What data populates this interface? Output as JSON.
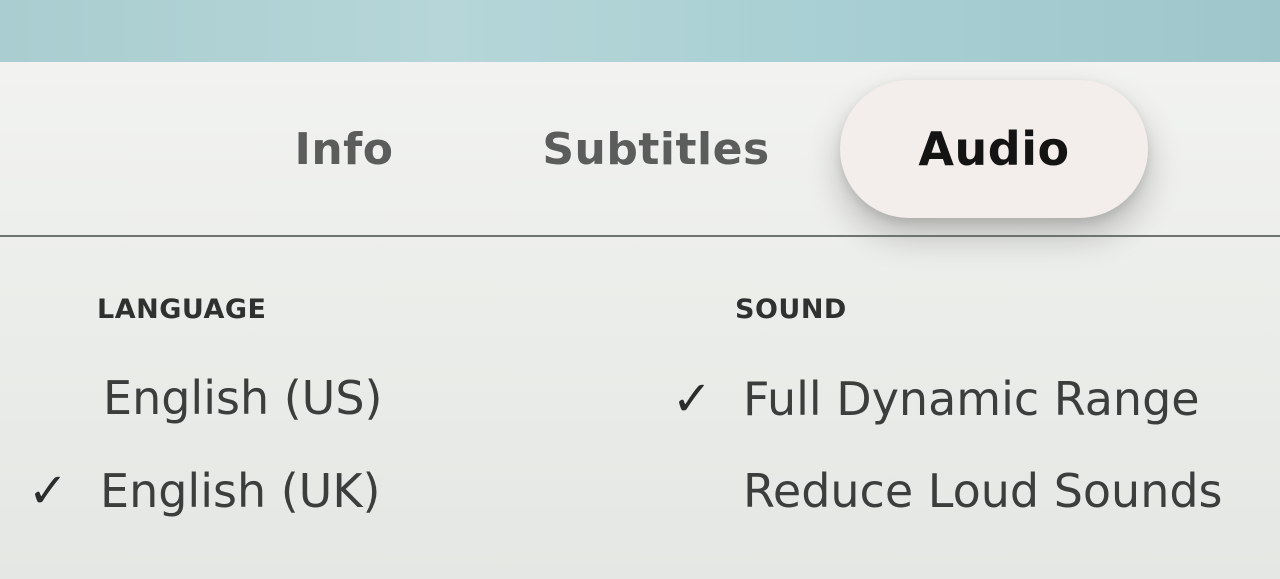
{
  "tabs": [
    {
      "label": "Info",
      "selected": false
    },
    {
      "label": "Subtitles",
      "selected": false
    },
    {
      "label": "Audio",
      "selected": true
    }
  ],
  "language": {
    "header": "LANGUAGE",
    "options": [
      {
        "label": "English (US)",
        "selected": false
      },
      {
        "label": "English (UK)",
        "selected": true
      }
    ]
  },
  "sound": {
    "header": "SOUND",
    "options": [
      {
        "label": "Full Dynamic Range",
        "selected": true
      },
      {
        "label": "Reduce Loud Sounds",
        "selected": false
      }
    ]
  },
  "icons": {
    "check_glyph": "✓",
    "check_icon_name": "checkmark-icon"
  },
  "colors": {
    "selected_tab_bg": "#f3edec",
    "text_primary": "#141414",
    "text_secondary": "#5b5d5c"
  }
}
